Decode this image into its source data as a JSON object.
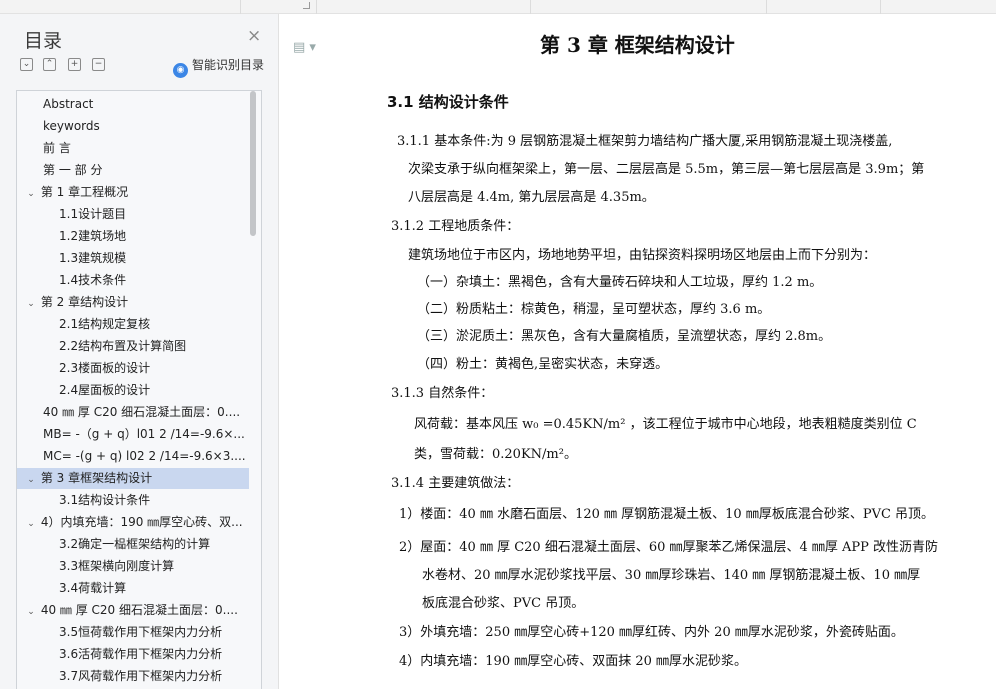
{
  "sidebar": {
    "title": "目录",
    "smart_toc_label": "智能识别目录",
    "items": [
      {
        "label": "Abstract",
        "level": 1,
        "chev": ""
      },
      {
        "label": "keywords",
        "level": 1,
        "chev": ""
      },
      {
        "label": "前    言",
        "level": 1,
        "chev": ""
      },
      {
        "label": "第 一 部 分",
        "level": 1,
        "chev": ""
      },
      {
        "label": "第 1 章工程概况",
        "level": 1,
        "chev": "v"
      },
      {
        "label": "1.1设计题目",
        "level": 2,
        "chev": ""
      },
      {
        "label": "1.2建筑场地",
        "level": 2,
        "chev": ""
      },
      {
        "label": "1.3建筑规模",
        "level": 2,
        "chev": ""
      },
      {
        "label": "1.4技术条件",
        "level": 2,
        "chev": ""
      },
      {
        "label": "第 2 章结构设计",
        "level": 1,
        "chev": "v"
      },
      {
        "label": "2.1结构规定复核",
        "level": 2,
        "chev": ""
      },
      {
        "label": "2.2结构布置及计算简图",
        "level": 2,
        "chev": ""
      },
      {
        "label": "2.3楼面板的设计",
        "level": 2,
        "chev": ""
      },
      {
        "label": "2.4屋面板的设计",
        "level": 2,
        "chev": ""
      },
      {
        "label": "40 ㎜ 厚 C20 细石混凝土面层：0....",
        "level": 1,
        "chev": ""
      },
      {
        "label": "MB= -（g + q）l01 2 /14=-9.6×...",
        "level": 1,
        "chev": ""
      },
      {
        "label": "MC= -(g + q) l02 2 /14=-9.6×3....",
        "level": 1,
        "chev": ""
      },
      {
        "label": "第 3 章框架结构设计",
        "level": 1,
        "chev": "v",
        "selected": true
      },
      {
        "label": "3.1结构设计条件",
        "level": 2,
        "chev": ""
      },
      {
        "label": "4）内填充墙：190 ㎜厚空心砖、双...",
        "level": 1,
        "chev": "v"
      },
      {
        "label": "3.2确定一榀框架结构的计算",
        "level": 2,
        "chev": ""
      },
      {
        "label": "3.3框架横向刚度计算",
        "level": 2,
        "chev": ""
      },
      {
        "label": "3.4荷载计算",
        "level": 2,
        "chev": ""
      },
      {
        "label": "40 ㎜ 厚 C20 细石混凝土面层：0....",
        "level": 1,
        "chev": "v"
      },
      {
        "label": "3.5恒荷载作用下框架内力分析",
        "level": 2,
        "chev": ""
      },
      {
        "label": "3.6活荷载作用下框架内力分析",
        "level": 2,
        "chev": ""
      },
      {
        "label": "3.7风荷载作用下框架内力分析",
        "level": 2,
        "chev": ""
      }
    ]
  },
  "document": {
    "chapter_title": "第 3 章 框架结构设计",
    "section_title": "3.1 结构设计条件",
    "lines": [
      {
        "text": "3.1.1 基本条件:为 9 层钢筋混凝土框架剪力墙结构广播大厦,采用钢筋混凝土现浇楼盖,"
      },
      {
        "text": "次梁支承于纵向框架梁上，第一层、二层层高是 5.5m，第三层—第七层层高是 3.9m；第"
      },
      {
        "text": "八层层高是 4.4m, 第九层层高是 4.35m。"
      },
      {
        "text": "3.1.2 工程地质条件："
      },
      {
        "text": "建筑场地位于市区内，场地地势平坦，由钻探资料探明场区地层由上而下分别为："
      },
      {
        "text": "（一）杂填土：黑褐色，含有大量砖石碎块和人工垃圾，厚约 1.2 m。"
      },
      {
        "text": "（二）粉质粘土：棕黄色，稍湿，呈可塑状态，厚约 3.6 m。"
      },
      {
        "text": "（三）淤泥质土：黑灰色，含有大量腐植质，呈流塑状态，厚约 2.8m。"
      },
      {
        "text": "（四）粉土：黄褐色,呈密实状态，未穿透。"
      },
      {
        "text": "3.1.3 自然条件："
      },
      {
        "text": "风荷载：基本风压 w₀ =0.45KN/m²  ，该工程位于城市中心地段，地表粗糙度类别位 C"
      },
      {
        "text": "类，雪荷载：0.20KN/m²。"
      },
      {
        "text": "3.1.4 主要建筑做法："
      },
      {
        "text": "1）楼面：40 ㎜ 水磨石面层、120 ㎜ 厚钢筋混凝土板、10 ㎜厚板底混合砂浆、PVC 吊顶。"
      },
      {
        "text": "2）屋面：40 ㎜ 厚 C20 细石混凝土面层、60 ㎜厚聚苯乙烯保温层、4 ㎜厚 APP 改性沥青防"
      },
      {
        "text": "水卷材、20 ㎜厚水泥砂浆找平层、30 ㎜厚珍珠岩、140 ㎜ 厚钢筋混凝土板、10 ㎜厚"
      },
      {
        "text": "板底混合砂浆、PVC 吊顶。"
      },
      {
        "text": "3）外填充墙：250 ㎜厚空心砖+120 ㎜厚红砖、内外 20 ㎜厚水泥砂浆，外瓷砖贴面。"
      },
      {
        "text": "4）内填充墙：190 ㎜厚空心砖、双面抹 20 ㎜厚水泥砂浆。"
      }
    ]
  }
}
